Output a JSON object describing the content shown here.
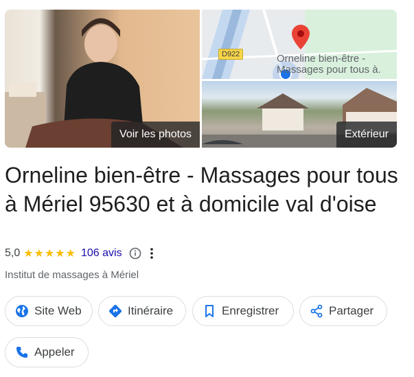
{
  "gallery": {
    "photos_label": "Voir les photos",
    "map_road_label": "D922",
    "map_place_label_line1": "Orneline bien-être -",
    "map_place_label_line2": "Massages pour tous à.",
    "exterior_label": "Extérieur"
  },
  "place": {
    "title": "Orneline bien-être - Massages pour tous à Mériel 95630 et à domicile val d'oise",
    "rating": "5,0",
    "stars": "★★★★★",
    "stars_value": 5,
    "reviews": "106 avis",
    "category": "Institut de massages à Mériel"
  },
  "actions": {
    "website": "Site Web",
    "directions": "Itinéraire",
    "save": "Enregistrer",
    "share": "Partager",
    "call": "Appeler"
  },
  "colors": {
    "accent": "#1a73e8",
    "star": "#fbbc04",
    "link": "#1a0dab",
    "pin": "#ea4335"
  }
}
